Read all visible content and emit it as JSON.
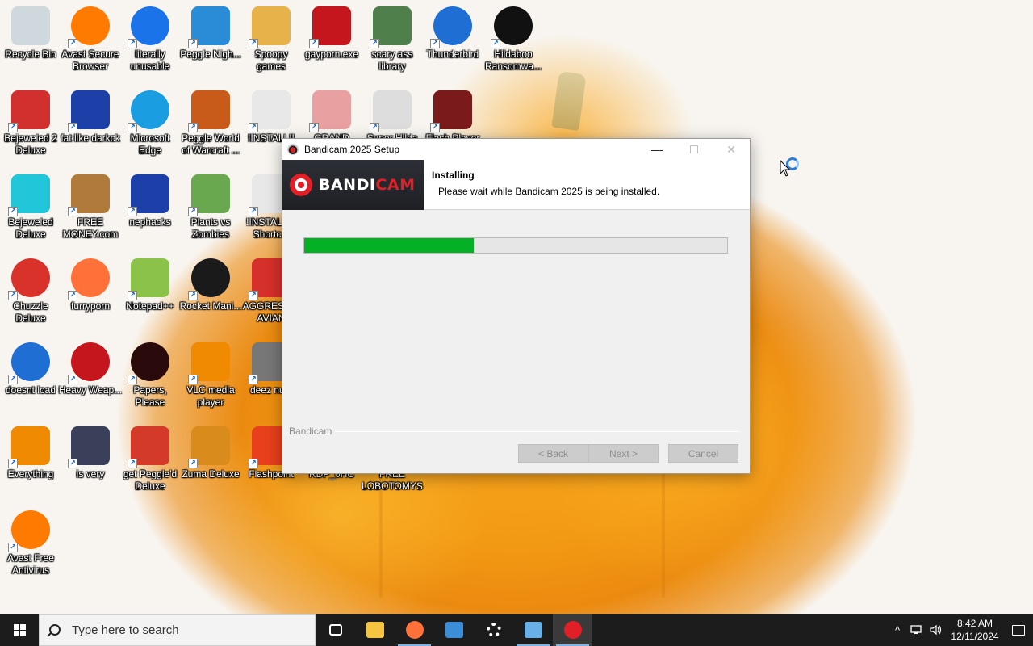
{
  "desktop": {
    "icons": [
      {
        "label": "Recycle Bin",
        "icon": "recycle-bin-icon",
        "color": "#cfd8dc"
      },
      {
        "label": "Avast Secure Browser",
        "icon": "avast-browser-icon",
        "color": "#ff7a00"
      },
      {
        "label": "literally unusable",
        "icon": "chrome-icon",
        "color": "#1a73e8"
      },
      {
        "label": "Peggle Nigh...",
        "icon": "peggle-icon",
        "color": "#2a8bd6"
      },
      {
        "label": "Spoopy games",
        "icon": "folder-icon",
        "color": "#e8b24a"
      },
      {
        "label": "gayporn.exe",
        "icon": "flash-icon",
        "color": "#c4161c"
      },
      {
        "label": "scary ass library",
        "icon": "library-icon",
        "color": "#4f7f4a"
      },
      {
        "label": "Thunderbird",
        "icon": "thunderbird-icon",
        "color": "#1f6ed4"
      },
      {
        "label": "Hildaboo Ransomwa...",
        "icon": "yashma-icon",
        "color": "#111111"
      },
      {
        "label": "Bejeweled 2 Deluxe",
        "icon": "bejeweled2-icon",
        "color": "#d22f2f"
      },
      {
        "label": "fat like darkck",
        "icon": "mpi-icon",
        "color": "#1d3fa8"
      },
      {
        "label": "Microsoft Edge",
        "icon": "edge-icon",
        "color": "#1b9de2"
      },
      {
        "label": "Peggle World of Warcraft ...",
        "icon": "peggle-wow-icon",
        "color": "#c85a1a"
      },
      {
        "label": "!INSTALL!!",
        "icon": "text-file-icon",
        "color": "#e8e8e8"
      },
      {
        "label": "GRAND",
        "icon": "anime-girl-icon",
        "color": "#e8a0a0"
      },
      {
        "label": "Super Hilda",
        "icon": "pixel-icon",
        "color": "#dddddd"
      },
      {
        "label": "Flash Player",
        "icon": "flash-player-icon",
        "color": "#7a1a1a"
      },
      {
        "label": "Bejeweled Deluxe",
        "icon": "gem-icon",
        "color": "#21c6d8"
      },
      {
        "label": "FREE MONEY.com",
        "icon": "money-bag-icon",
        "color": "#b07a3a"
      },
      {
        "label": "nephacks",
        "icon": "mpi-icon",
        "color": "#1d3fa8"
      },
      {
        "label": "Plants vs Zombies",
        "icon": "pvz-icon",
        "color": "#6aa84f"
      },
      {
        "label": "!INSTALL! - Shortc...",
        "icon": "text-file-icon",
        "color": "#e8e8e8"
      },
      {
        "label": "Chuzzle Deluxe",
        "icon": "chuzzle-icon",
        "color": "#d9322b"
      },
      {
        "label": "furryporn",
        "icon": "firefox-icon",
        "color": "#ff7139"
      },
      {
        "label": "Notepad++",
        "icon": "notepadpp-icon",
        "color": "#8bc34a"
      },
      {
        "label": "Rocket Mani...",
        "icon": "rocket-icon",
        "color": "#1a1a1a"
      },
      {
        "label": "AGGRESSIV AVIAN",
        "icon": "angry-bird-icon",
        "color": "#d6302b"
      },
      {
        "label": "doesnt load",
        "icon": "thunderbird-icon",
        "color": "#1f6ed4"
      },
      {
        "label": "Heavy Weap...",
        "icon": "radiation-icon",
        "color": "#c4161c"
      },
      {
        "label": "Papers, Please",
        "icon": "papers-please-icon",
        "color": "#2a0a0a"
      },
      {
        "label": "VLC media player",
        "icon": "vlc-icon",
        "color": "#f08a00"
      },
      {
        "label": "deez nuts",
        "icon": "stack-icon",
        "color": "#777777"
      },
      {
        "label": "Everything",
        "icon": "search-magnifier-icon",
        "color": "#f08a00"
      },
      {
        "label": "is very",
        "icon": "mpi-shield-icon",
        "color": "#3a3f5a"
      },
      {
        "label": "get Peggle'd Deluxe",
        "icon": "peggle-icon",
        "color": "#d33a2a"
      },
      {
        "label": "Zuma Deluxe",
        "icon": "zuma-icon",
        "color": "#d98b1c"
      },
      {
        "label": "Flashpoint",
        "icon": "flashpoint-icon",
        "color": "#e8401c"
      },
      {
        "label": "RDP_0HC",
        "icon": "rdp-icon",
        "color": "#e8a43a"
      },
      {
        "label": "FREE LOBOTOMYS",
        "icon": "free-icon",
        "color": "#e8a43a"
      },
      {
        "label": "Avast Free Antivirus",
        "icon": "avast-icon",
        "color": "#ff7a00"
      }
    ]
  },
  "dialog": {
    "title": "Bandicam 2025 Setup",
    "logo_text_1": "BANDI",
    "logo_text_2": "CAM",
    "header_title": "Installing",
    "header_subtitle": "Please wait while Bandicam 2025 is being installed.",
    "progress_fraction": 0.4,
    "branding": "Bandicam",
    "back_label": "< Back",
    "next_label": "Next >",
    "cancel_label": "Cancel",
    "minimize_glyph": "—",
    "close_glyph": "✕"
  },
  "taskbar": {
    "search_placeholder": "Type here to search",
    "apps": [
      {
        "name": "task-view",
        "color": "#ffffff"
      },
      {
        "name": "file-explorer",
        "color": "#f5c542"
      },
      {
        "name": "firefox",
        "color": "#ff7139"
      },
      {
        "name": "microsoft-store",
        "color": "#3b8ed8"
      },
      {
        "name": "settings",
        "color": "#ffffff"
      },
      {
        "name": "control-panel",
        "color": "#6ab0e8"
      },
      {
        "name": "bandicam-setup",
        "color": "#e01f26"
      }
    ],
    "tray_up": "^",
    "time": "8:42 AM",
    "date": "12/11/2024"
  }
}
